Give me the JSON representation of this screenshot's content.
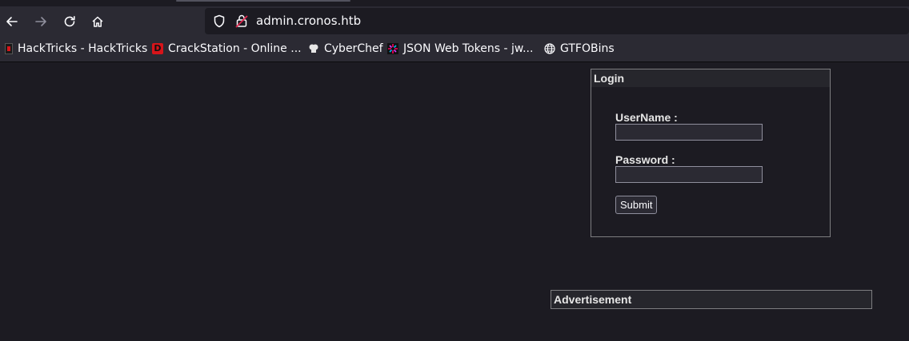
{
  "browser": {
    "url": "admin.cronos.htb",
    "bookmarks": [
      {
        "label": "HackTricks - HackTricks",
        "icon": "hacktricks-icon"
      },
      {
        "label": "CrackStation - Online ...",
        "icon": "crackstation-icon"
      },
      {
        "label": "CyberChef",
        "icon": "cyberchef-icon"
      },
      {
        "label": "JSON Web Tokens - jw...",
        "icon": "jwt-icon"
      },
      {
        "label": "GTFOBins",
        "icon": "globe-icon"
      }
    ]
  },
  "login": {
    "legend": "Login",
    "username_label": "UserName :",
    "username_value": "",
    "password_label": "Password :",
    "password_value": "",
    "submit_label": "Submit"
  },
  "advertisement": {
    "legend": "Advertisement"
  },
  "colors": {
    "toolbar_bg": "#2b2a33",
    "page_bg": "#1c1b22",
    "crackstation_red": "#d7141a",
    "lock_red": "#e22850"
  }
}
